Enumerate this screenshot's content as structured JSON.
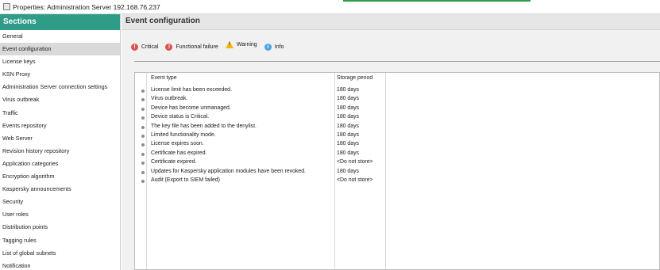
{
  "window": {
    "title": "Properties: Administration Server 192.168.76.237"
  },
  "sidebar": {
    "heading": "Sections",
    "items": [
      {
        "label": "General"
      },
      {
        "label": "Event configuration"
      },
      {
        "label": "License keys"
      },
      {
        "label": "KSN Proxy"
      },
      {
        "label": "Administration Server connection settings"
      },
      {
        "label": "Virus outbreak"
      },
      {
        "label": "Traffic"
      },
      {
        "label": "Events repository"
      },
      {
        "label": "Web Server"
      },
      {
        "label": "Revision history repository"
      },
      {
        "label": "Application categories"
      },
      {
        "label": "Encryption algorithm"
      },
      {
        "label": "Kaspersky announcements"
      },
      {
        "label": "Security"
      },
      {
        "label": "User roles"
      },
      {
        "label": "Distribution points"
      },
      {
        "label": "Tagging rules"
      },
      {
        "label": "List of global subnets"
      },
      {
        "label": "Notification"
      }
    ],
    "selected": "Event configuration"
  },
  "main": {
    "title": "Event configuration",
    "filters": [
      {
        "label": "Critical",
        "icon": "critical-icon",
        "color": "#d9544f"
      },
      {
        "label": "Functional failure",
        "icon": "functional-failure-icon",
        "color": "#d9544f"
      },
      {
        "label": "Warning",
        "icon": "warning-icon",
        "color": "#f2b705"
      },
      {
        "label": "Info",
        "icon": "info-icon",
        "color": "#4aa3df"
      }
    ],
    "table": {
      "columns": [
        "Event type",
        "Storage period"
      ],
      "rows": [
        [
          "License limit has been exceeded.",
          "180 days"
        ],
        [
          "Virus outbreak.",
          "180 days"
        ],
        [
          "Device has become unmanaged.",
          "180 days"
        ],
        [
          "Device status is Critical.",
          "180 days"
        ],
        [
          "The key file has been added to the denylist.",
          "180 days"
        ],
        [
          "Limited functionality mode.",
          "180 days"
        ],
        [
          "License expires soon.",
          "180 days"
        ],
        [
          "Certificate has expired.",
          "180 days"
        ],
        [
          "Certificate expired.",
          "<Do not store>"
        ],
        [
          "Updates for Kaspersky application modules have been revoked.",
          "180 days"
        ],
        [
          "Audit (Export to SIEM failed)",
          "<Do not store>"
        ]
      ]
    }
  },
  "colors": {
    "sidebar_header": "#2e9c87",
    "accent": "#2e9b46",
    "selected_item": "#d9d9d9"
  }
}
